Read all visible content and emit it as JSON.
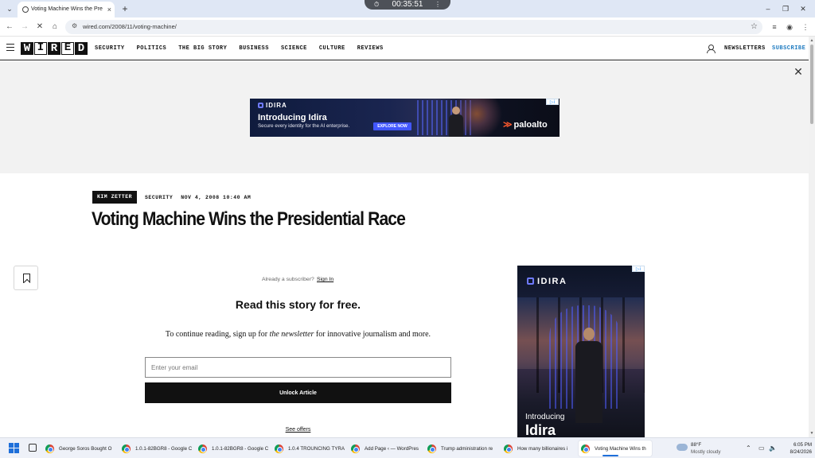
{
  "browser": {
    "tab_title": "Voting Machine Wins the Presidential R",
    "tab_close": "×",
    "new_tab": "+",
    "timer": "00:35:51",
    "url": "wired.com/2008/11/voting-machine/",
    "controls": {
      "minimize": "–",
      "restore": "❐",
      "close": "✕"
    }
  },
  "site_nav": {
    "logo": [
      "W",
      "I",
      "R",
      "E",
      "D"
    ],
    "links": [
      "SECURITY",
      "POLITICS",
      "THE BIG STORY",
      "BUSINESS",
      "SCIENCE",
      "CULTURE",
      "REVIEWS"
    ],
    "newsletters": "NEWSLETTERS",
    "subscribe": "SUBSCRIBE",
    "subscribe_color": "#1f7bc0"
  },
  "banner_ad": {
    "brand": "IDIRA",
    "headline": "Introducing Idira",
    "subline": "Secure every identity for the AI enterprise.",
    "cta": "EXPLORE NOW",
    "partner": "paloalto",
    "close": "✕"
  },
  "article": {
    "author": "KIM ZETTER",
    "category": "SECURITY",
    "date": "NOV 4, 2008 10:40 AM",
    "headline": "Voting Machine Wins the Presidential Race"
  },
  "paywall": {
    "already": "Already a subscriber?",
    "signin": "Sign In",
    "title": "Read this story for free.",
    "body_pre": "To continue reading, sign up for ",
    "body_em": "the newsletter",
    "body_post": " for innovative journalism and more.",
    "email_placeholder": "Enter your email",
    "unlock": "Unlock Article",
    "offers": "See offers"
  },
  "side_ad": {
    "brand": "IDIRA",
    "intro": "Introducing",
    "headline": "Idira"
  },
  "taskbar": {
    "apps": [
      "George Soros Bought O",
      "1.0.1-82BGR8 - Google C",
      "1.0.1-82BGR8 - Google C",
      "1.0.4 TROUNCING TYRA",
      "Add Page ‹ — WordPres",
      "Trump administration re",
      "How many billionaires i",
      "Voting Machine Wins th"
    ],
    "weather_temp": "88°F",
    "weather_cond": "Mostly cloudy",
    "time": "6:05 PM",
    "date": "8/24/2026"
  }
}
